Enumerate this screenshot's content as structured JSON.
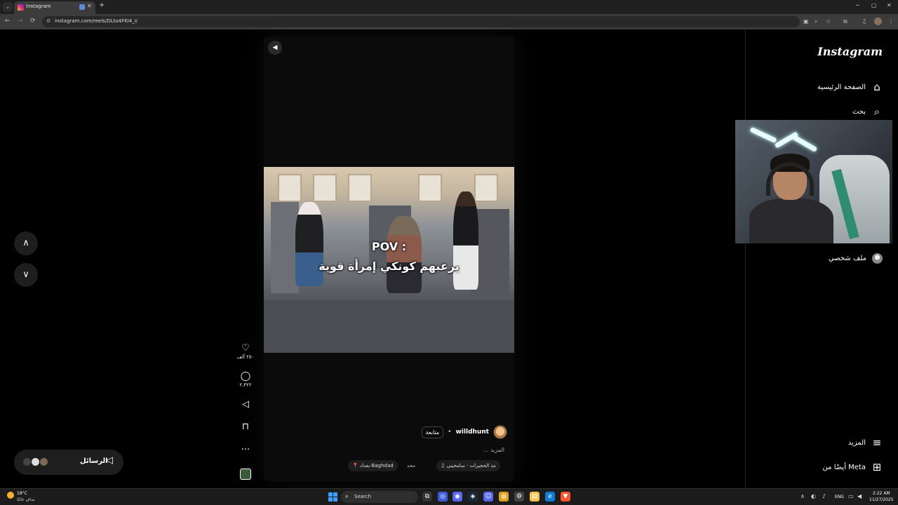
{
  "browser": {
    "tab_title": "Instagram",
    "tab_close": "✕",
    "new_tab": "+",
    "url": "instagram.com/reels/DLto4FKI4_i/",
    "window_controls": [
      "─",
      "▢",
      "✕"
    ]
  },
  "reel": {
    "caption_line1": "POV :",
    "caption_line2": "يرعبهم كونكي إمرأة قوية",
    "author": "willdhunt",
    "follow_label": "متابعة",
    "separator": "•",
    "more_label": "... المزيد",
    "audio_label": "♫ مذ الحجيرات · سامحيني",
    "audio_extra": "محد",
    "location_label": "📍 بغداد-Baghdad"
  },
  "actions": {
    "likes": "٢٥٠ ألف",
    "comments": "٢،٣٢٢"
  },
  "messages": {
    "label": "الرسائل"
  },
  "sidebar": {
    "logo": "Instagram",
    "home": "الصفحة الرئيسية",
    "search": "بحث",
    "profile": "ملف شخصي",
    "more": "المزيد",
    "also_from_meta": "أيضًا من Meta"
  },
  "taskbar": {
    "weather_temp": "18°C",
    "weather_desc": "صافٍ غالبًا",
    "search_label": "Search",
    "lang": "ENG",
    "time": "2:22 AM",
    "date": "11/27/2025"
  },
  "colors": {
    "background": "#000000",
    "surface": "#1e1e1e",
    "accent_instagram": "#ee2a7b"
  }
}
